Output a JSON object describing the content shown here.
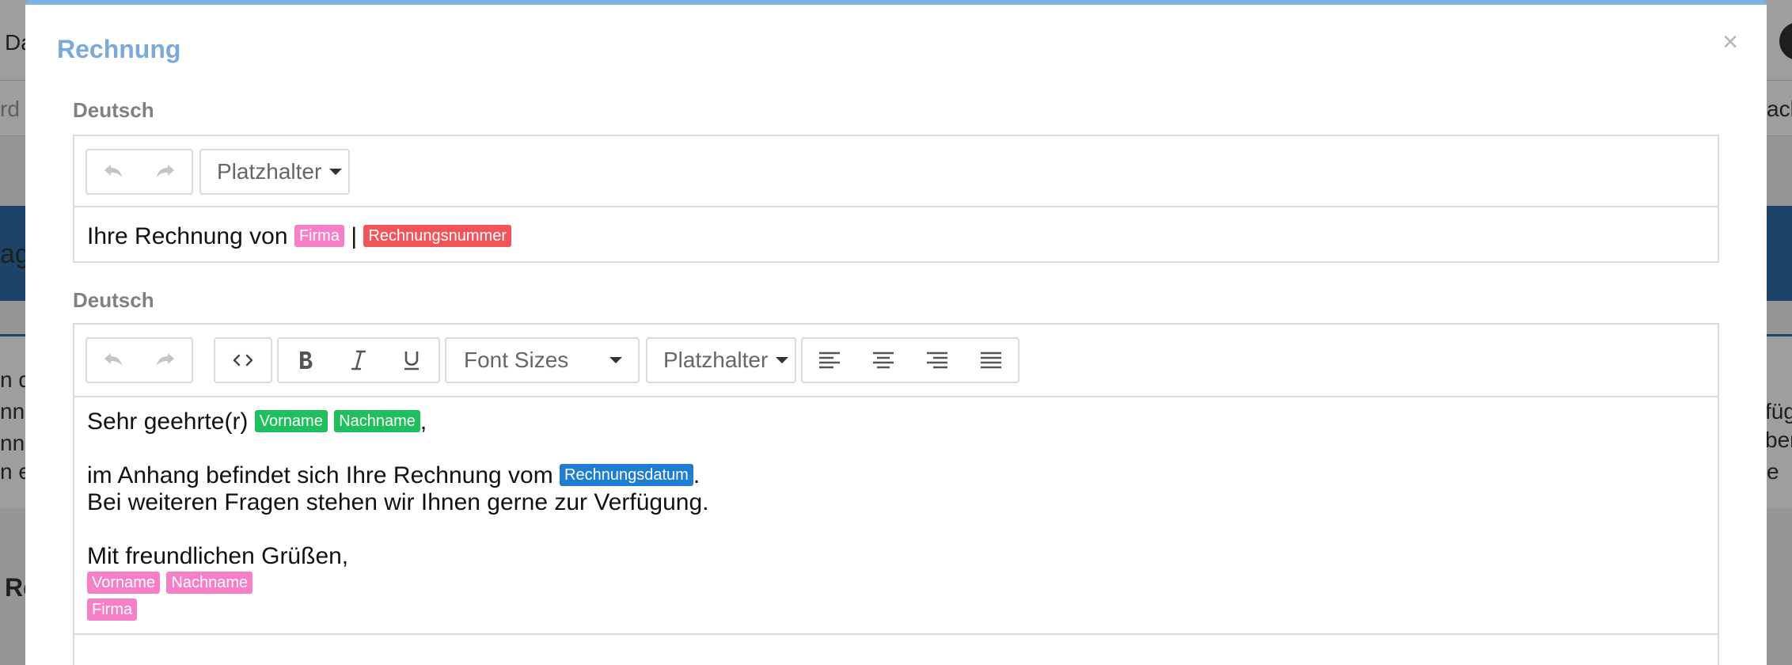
{
  "background": {
    "fragments": [
      "Da",
      "rd",
      "ag",
      "n di",
      "nn",
      "nn",
      "n ei",
      "Re",
      "ack",
      "füg",
      "ber",
      "e"
    ]
  },
  "modal": {
    "title": "Rechnung",
    "close_label": "×"
  },
  "subject_editor": {
    "label": "Deutsch",
    "placeholder_dropdown": "Platzhalter",
    "content": {
      "text_before": "Ihre Rechnung von",
      "tag_1": "Firma",
      "separator": "|",
      "tag_2": "Rechnungsnummer"
    }
  },
  "body_editor": {
    "label": "Deutsch",
    "font_sizes_dropdown": "Font Sizes",
    "placeholder_dropdown": "Platzhalter",
    "icons": [
      "undo-icon",
      "redo-icon",
      "code-icon",
      "bold-icon",
      "italic-icon",
      "underline-icon",
      "align-left-icon",
      "align-center-icon",
      "align-right-icon",
      "align-justify-icon"
    ],
    "content": {
      "greeting": "Sehr geehrte(r)",
      "greeting_tag_1": "Vorname",
      "greeting_tag_2": "Nachname",
      "greeting_end": ",",
      "line2_text": "im Anhang befindet sich Ihre Rechnung vom",
      "line2_tag": "Rechnungsdatum",
      "line2_end": ".",
      "line3": "Bei weiteren Fragen stehen wir Ihnen gerne zur Verfügung.",
      "closing": "Mit freundlichen Grüßen,",
      "sign_tag_1": "Vorname",
      "sign_tag_2": "Nachname",
      "sign_tag_3": "Firma"
    }
  },
  "colors": {
    "title": "#7aaad8",
    "modal_top_border": "#7cb4e3",
    "tag_pink": "#f77fc8",
    "tag_red": "#f2545b",
    "tag_green": "#1fbf5d",
    "tag_blue": "#1f7ed1"
  }
}
